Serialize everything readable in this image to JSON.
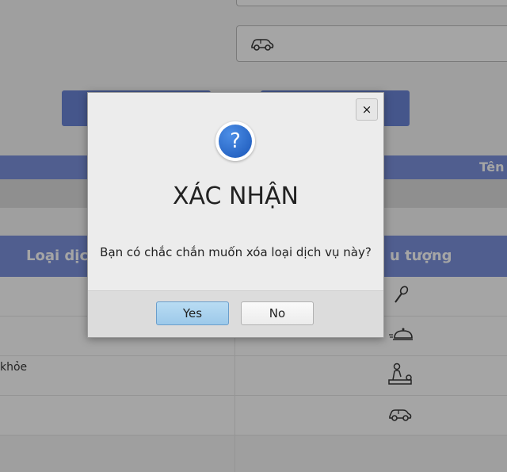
{
  "background": {
    "table": {
      "col_header_1": "Loại dịch",
      "col_header_2": "u tượng",
      "top_right_header": "Tên",
      "rows": [
        {
          "text": "",
          "icon": "microphone-icon"
        },
        {
          "text": "",
          "icon": "food-service-icon"
        },
        {
          "text": "khỏe",
          "icon": "massage-icon"
        },
        {
          "text": "",
          "icon": "car-icon"
        }
      ]
    },
    "field_icon": "car-icon"
  },
  "dialog": {
    "title": "XÁC NHẬN",
    "message": "Bạn có chắc chắn muốn xóa loại dịch vụ này?",
    "yes_label": "Yes",
    "no_label": "No",
    "close_label": "×",
    "question_mark": "?"
  },
  "colors": {
    "header_blue": "#6d86d9",
    "button_blue": "#5b77d3",
    "yes_button": "#a6d0ee"
  }
}
